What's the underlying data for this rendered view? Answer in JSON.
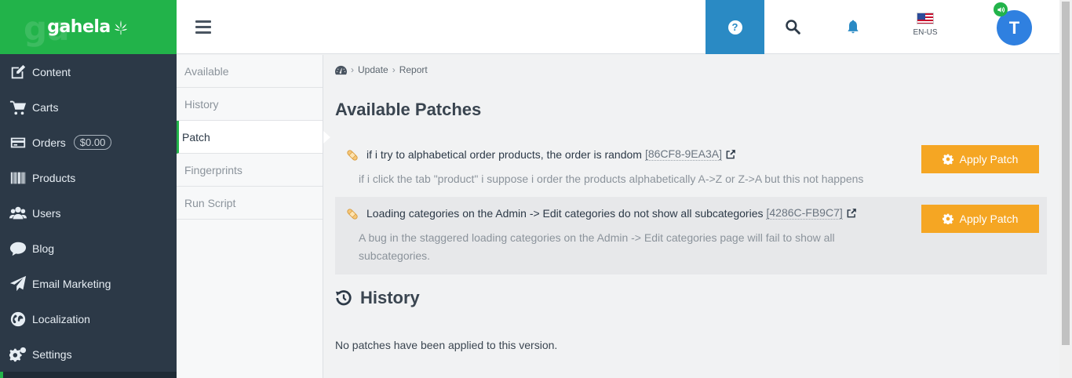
{
  "brand": {
    "name": "gahela"
  },
  "sidebar": {
    "items": [
      {
        "label": "Content",
        "icon": "edit-icon"
      },
      {
        "label": "Carts",
        "icon": "cart-icon"
      },
      {
        "label": "Orders",
        "icon": "credit-card-icon",
        "badge": "$0.00"
      },
      {
        "label": "Products",
        "icon": "barcode-icon"
      },
      {
        "label": "Users",
        "icon": "users-icon"
      },
      {
        "label": "Blog",
        "icon": "comment-icon"
      },
      {
        "label": "Email Marketing",
        "icon": "paper-plane-icon"
      },
      {
        "label": "Localization",
        "icon": "globe-icon"
      },
      {
        "label": "Settings",
        "icon": "gears-icon"
      }
    ]
  },
  "topbar": {
    "language": "EN-US",
    "user_initial": "T"
  },
  "subnav": {
    "items": [
      {
        "label": "Available"
      },
      {
        "label": "History"
      },
      {
        "label": "Patch"
      },
      {
        "label": "Fingerprints"
      },
      {
        "label": "Run Script"
      }
    ]
  },
  "breadcrumb": [
    "Update",
    "Report"
  ],
  "main": {
    "title": "Available Patches",
    "patches": [
      {
        "title": "if i try to alphabetical order products, the order is random",
        "id": "[86CF8-9EA3A]",
        "description": "if i click the tab \"product\" i suppose i order the products alphabetically A->Z or Z->A but this not happens",
        "button": "Apply Patch"
      },
      {
        "title": "Loading categories on the Admin -> Edit categories do not show all subcategories",
        "id": "[4286C-FB9C7]",
        "description": "A bug in the staggered loading categories on the Admin -> Edit categories page will fail to show all subcategories.",
        "button": "Apply Patch"
      }
    ],
    "history_title": "History",
    "history_empty": "No patches have been applied to this version."
  },
  "colors": {
    "brand_green": "#22b34a",
    "sidebar_bg": "#2c3947",
    "help_blue": "#2a8ac4",
    "apply_orange": "#f5a623",
    "avatar_blue": "#2f80e0"
  }
}
